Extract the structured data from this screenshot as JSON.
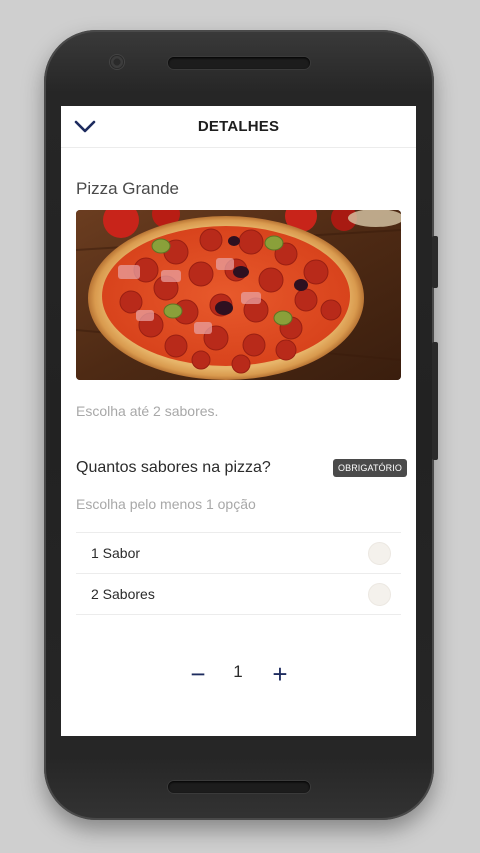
{
  "header": {
    "title": "DETALHES",
    "back_icon": "chevron-down-icon"
  },
  "product": {
    "name": "Pizza Grande",
    "image": "pepperoni-pizza-photo",
    "hint": "Escolha até 2 sabores."
  },
  "question": {
    "title": "Quantos sabores na pizza?",
    "badge": "OBRIGATÓRIO",
    "hint": "Escolha pelo menos 1 opção",
    "options": [
      {
        "label": "1 Sabor",
        "selected": false
      },
      {
        "label": "2 Sabores",
        "selected": false
      }
    ]
  },
  "quantity": {
    "minus": "−",
    "value": "1",
    "plus": "+"
  },
  "colors": {
    "accent": "#1d2b5e",
    "badge_bg": "#4a4a4a",
    "hint_text": "#a8a8a8"
  }
}
